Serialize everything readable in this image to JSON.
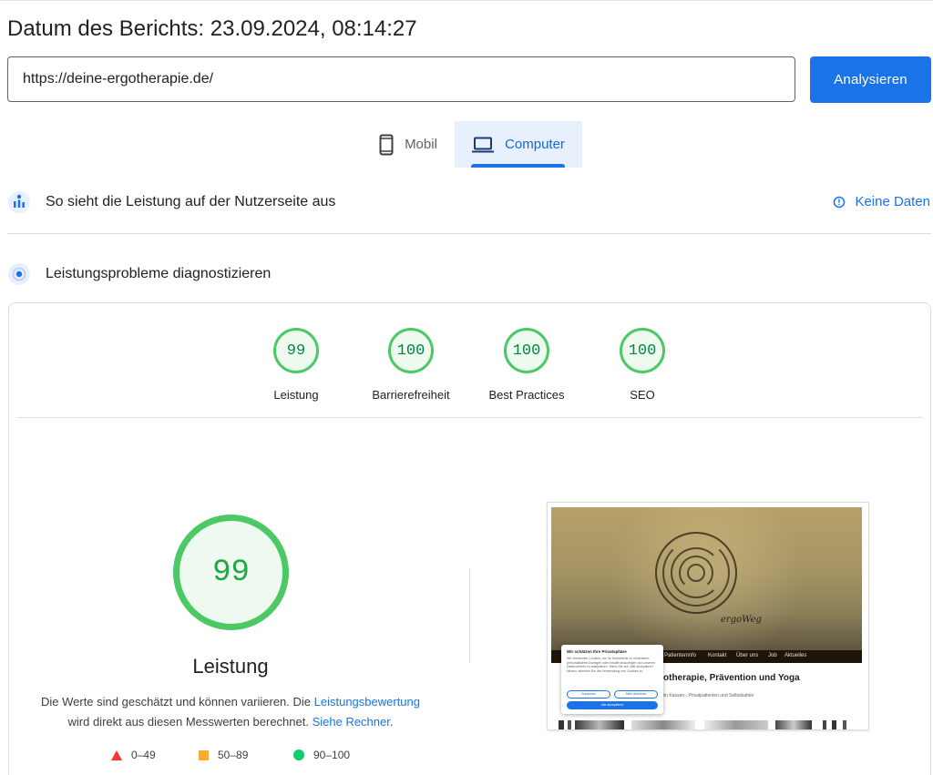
{
  "header": {
    "report_date": "Datum des Berichts: 23.09.2024, 08:14:27",
    "url_value": "https://deine-ergotherapie.de/",
    "analyze_label": "Analysieren"
  },
  "tabs": [
    {
      "label": "Mobil",
      "icon": "smartphone-icon",
      "selected": false
    },
    {
      "label": "Computer",
      "icon": "laptop-icon",
      "selected": true
    }
  ],
  "field_data": {
    "title": "So sieht die Leistung auf der Nutzerseite aus",
    "icon": "people-chart-icon",
    "status_label": "Keine Daten",
    "status_icon": "info-icon"
  },
  "diagnose": {
    "title": "Leistungsprobleme diagnostizieren",
    "icon": "lighthouse-icon"
  },
  "scores": [
    {
      "value": "99",
      "label": "Leistung"
    },
    {
      "value": "100",
      "label": "Barrierefreiheit"
    },
    {
      "value": "100",
      "label": "Best Practices"
    },
    {
      "value": "100",
      "label": "SEO"
    }
  ],
  "performance": {
    "value": "99",
    "label": "Leistung",
    "desc_1": "Die Werte sind geschätzt und können variieren. Die ",
    "link_1": "Leistungsbewertung",
    "desc_2": "wird direkt aus diesen Messwerten berechnet. ",
    "link_2": "Siehe Rechner",
    "desc_3": "."
  },
  "legend": [
    {
      "range": "0–49",
      "shape": "triangle",
      "color": "#ff3333"
    },
    {
      "range": "50–89",
      "shape": "square",
      "color": "#ffaa33"
    },
    {
      "range": "90–100",
      "shape": "circle",
      "color": "#0cce6b"
    }
  ],
  "screenshot": {
    "script_text": "ergoWeg",
    "nav": [
      "Patienteninfo",
      "Kontakt",
      "Über uns",
      "Job",
      "Aktuelles"
    ],
    "headline": "rgotherapie, Prävention und Yoga",
    "subline": "andeln Kassen-, Privatpatienten und Selbstzahler",
    "cookie": {
      "title": "Wir schätzen Ihre Privatsphäre",
      "body": "Wir verwenden Cookies, um Ihr Surfelebnis zu verbessern, personalisierte Anzeigen oder Inhalte anzuzeigen und unseren Datenverkehr zu analysieren. Wenn Sie auf „Alle akzeptieren“ klicken, stimmen Sie der Verwendung von Cookies zu.",
      "btn_customize": "Anpassen",
      "btn_reject": "Alles ablehnen",
      "btn_accept": "Alle akzeptieren"
    }
  },
  "colors": {
    "accent": "#1a73e8",
    "pass": "#0cce6b",
    "pass_text": "#018642",
    "average": "#ffaa33",
    "fail": "#ff3333"
  }
}
